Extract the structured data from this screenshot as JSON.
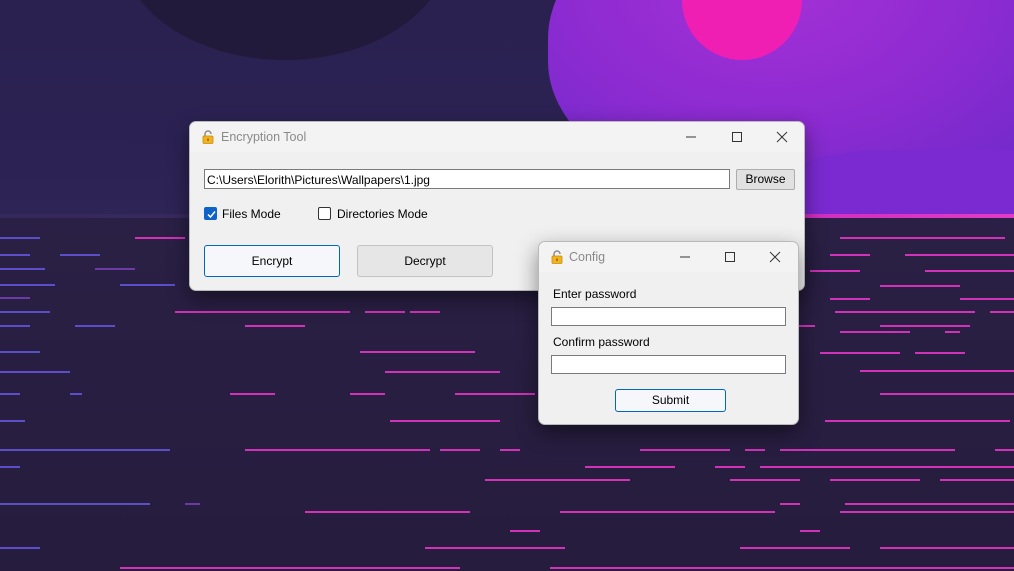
{
  "main_window": {
    "title": "Encryption Tool",
    "file_path": "C:\\Users\\Elorith\\Pictures\\Wallpapers\\1.jpg",
    "browse_label": "Browse",
    "files_mode": {
      "label": "Files Mode",
      "checked": true
    },
    "directories_mode": {
      "label": "Directories Mode",
      "checked": false
    },
    "encrypt_label": "Encrypt",
    "decrypt_label": "Decrypt"
  },
  "config_window": {
    "title": "Config",
    "password_label": "Enter password",
    "password_value": "",
    "confirm_label": "Confirm password",
    "confirm_value": "",
    "submit_label": "Submit"
  },
  "icons": {
    "title_icon": "padlock-icon",
    "minimize": "minimize-icon",
    "maximize": "maximize-icon",
    "close": "close-icon",
    "checkmark": "checkmark-icon"
  },
  "colors": {
    "accent": "#0067c0",
    "checkbox_checked": "#0f62c9",
    "wallpaper_purple": "#8c2bd1",
    "wallpaper_pink": "#f01fb4",
    "wallpaper_dark": "#261c3d"
  }
}
